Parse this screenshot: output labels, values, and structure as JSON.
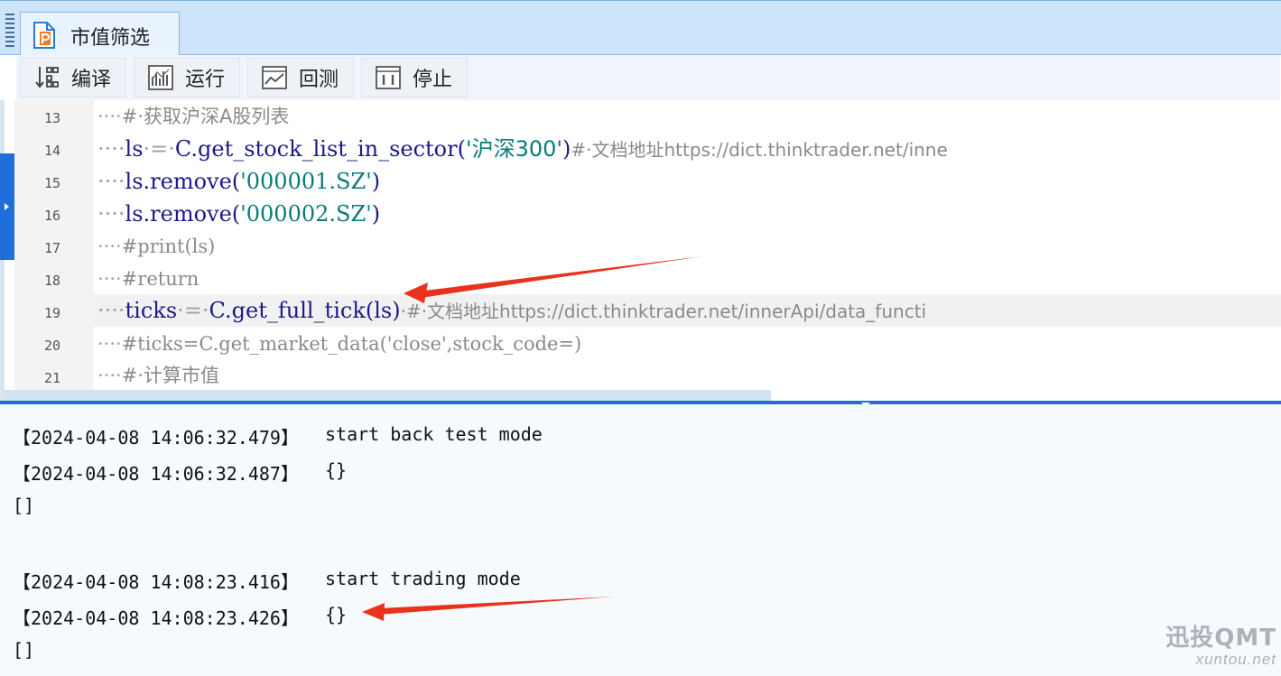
{
  "tab": {
    "title": "市值筛选",
    "icon": "strategy-file-icon"
  },
  "toolbar": {
    "compile_label": "编译",
    "run_label": "运行",
    "backtest_label": "回测",
    "stop_label": "停止"
  },
  "editor": {
    "lines": [
      {
        "num": "13",
        "dots": "····",
        "parts": {
          "a": "#·获取沪深A股列表"
        }
      },
      {
        "num": "14",
        "dots": "····",
        "parts": {
          "a": "ls",
          "b": "·=·",
          "c": "C.get_stock_list_in_sector(",
          "d": "'沪深300'",
          "e": ")",
          "f": "#·文档地址https://dict.thinktrader.net/inne"
        }
      },
      {
        "num": "15",
        "dots": "····",
        "parts": {
          "a": "ls.remove(",
          "b": "'000001.SZ'",
          "c": ")"
        }
      },
      {
        "num": "16",
        "dots": "····",
        "parts": {
          "a": "ls.remove(",
          "b": "'000002.SZ'",
          "c": ")"
        }
      },
      {
        "num": "17",
        "dots": "····",
        "parts": {
          "a": "#print(ls)"
        }
      },
      {
        "num": "18",
        "dots": "····",
        "parts": {
          "a": "#return"
        }
      },
      {
        "num": "19",
        "dots": "····",
        "parts": {
          "a": "ticks",
          "b": "·=·",
          "c": "C.get_full_tick(ls)",
          "d": "·#·文档地址https://dict.thinktrader.net/innerApi/data_functi"
        }
      },
      {
        "num": "20",
        "dots": "····",
        "parts": {
          "a": "#ticks=C.get_market_data('close',stock_code=)"
        }
      },
      {
        "num": "21",
        "dots": "····",
        "parts": {
          "a": "#·计算市值"
        }
      }
    ]
  },
  "output": {
    "lines": [
      {
        "ts": "【2024-04-08 14:06:32.479】",
        "msg": "start back test mode"
      },
      {
        "ts": "【2024-04-08 14:06:32.487】",
        "msg": "{}"
      },
      {
        "ts": "[]",
        "msg": ""
      },
      {
        "ts": "【2024-04-08 14:08:23.416】",
        "msg": "start trading mode"
      },
      {
        "ts": "【2024-04-08 14:08:23.426】",
        "msg": "{}"
      },
      {
        "ts": "[]",
        "msg": ""
      }
    ]
  },
  "watermark": {
    "brand": "迅投QMT",
    "site": "xuntou.net"
  },
  "colors": {
    "accent": "#1e6fd9",
    "arrow": "#e8321e",
    "titlebar": "#cde4fb"
  }
}
